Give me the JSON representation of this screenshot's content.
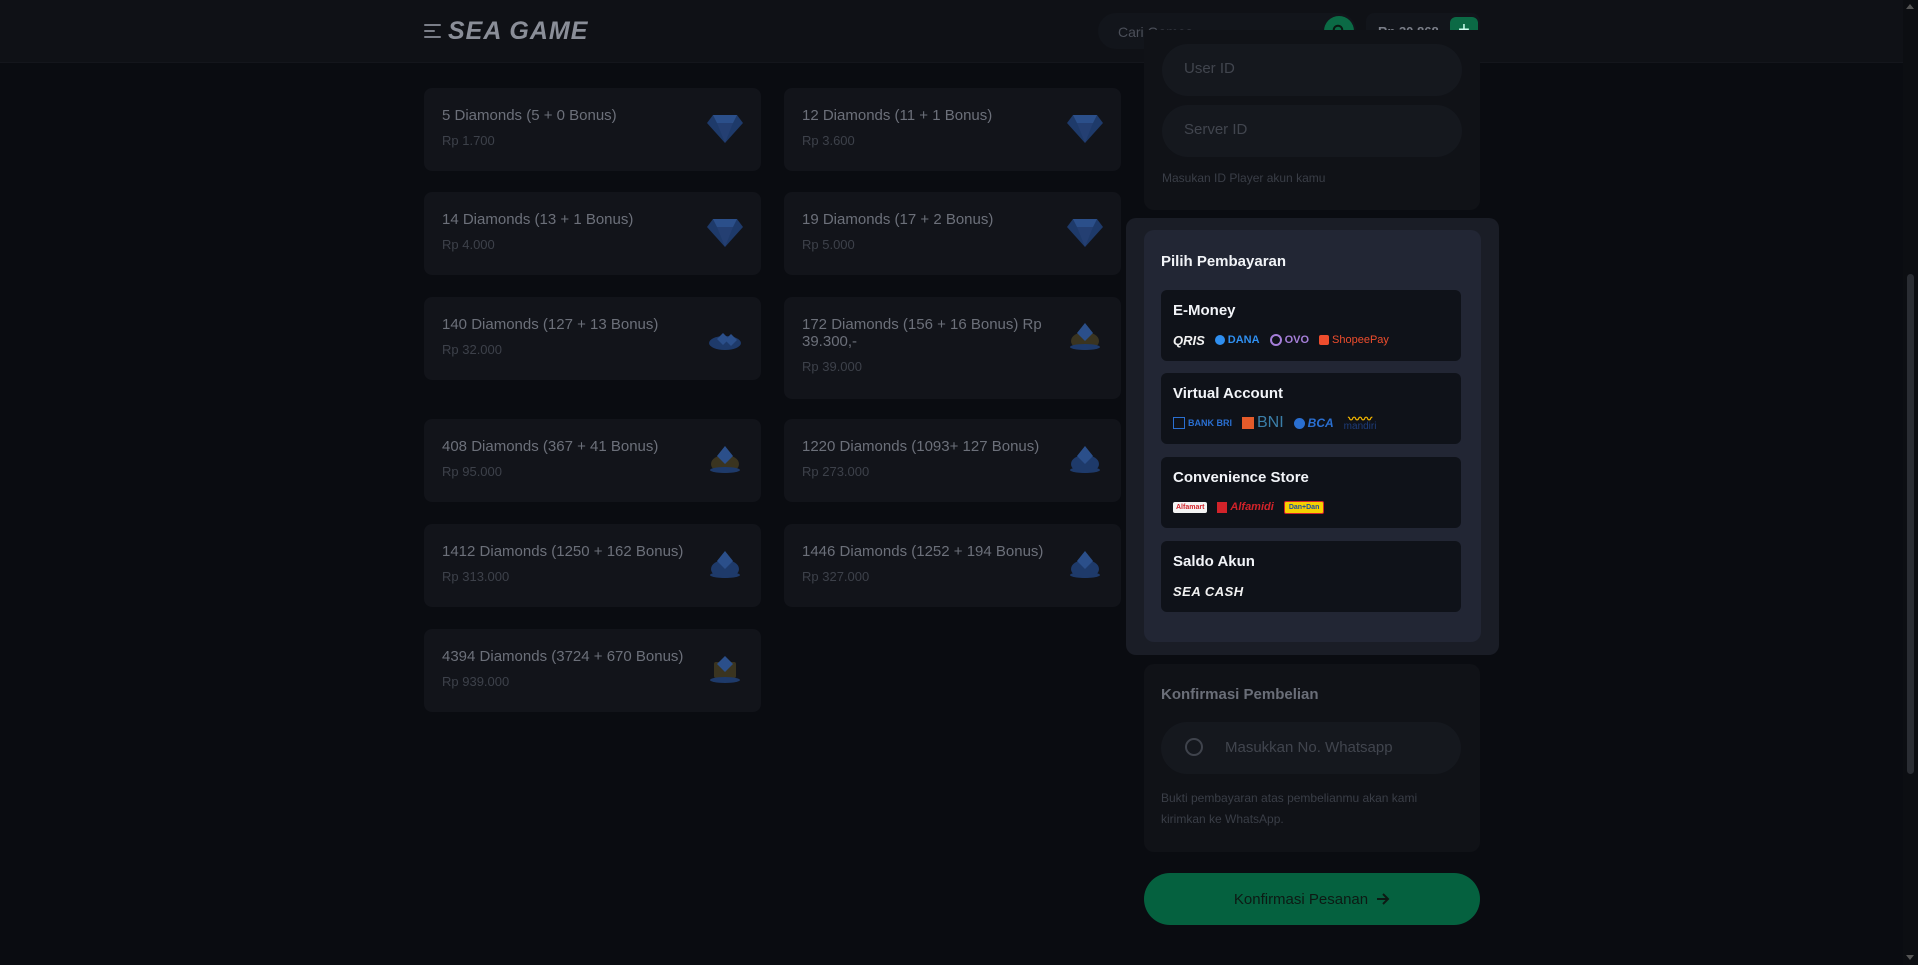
{
  "header": {
    "logo": "SEA GAME",
    "search_placeholder": "Cari Games",
    "balance": "Rp 30.868",
    "topup_label": "+"
  },
  "products": [
    {
      "name": "5 Diamonds (5 + 0 Bonus)",
      "price": "Rp 1.700",
      "icon": "diamond-icon"
    },
    {
      "name": "12 Diamonds (11 + 1 Bonus)",
      "price": "Rp 3.600",
      "icon": "diamond-icon"
    },
    {
      "name": "14 Diamonds (13 + 1 Bonus)",
      "price": "Rp 4.000",
      "icon": "diamond-icon"
    },
    {
      "name": "19 Diamonds (17 + 2 Bonus)",
      "price": "Rp 5.000",
      "icon": "diamond-icon"
    },
    {
      "name": "140 Diamonds (127 + 13 Bonus)",
      "price": "Rp 32.000",
      "icon": "diamond-pile-icon"
    },
    {
      "name": "172 Diamonds (156 + 16 Bonus) Rp 39.300,-",
      "price": "Rp 39.000",
      "icon": "diamond-bag-icon"
    },
    {
      "name": "408 Diamonds (367 + 41 Bonus)",
      "price": "Rp 95.000",
      "icon": "diamond-bag-icon"
    },
    {
      "name": "1220 Diamonds (1093+ 127 Bonus)",
      "price": "Rp 273.000",
      "icon": "diamond-bag-icon"
    },
    {
      "name": "1412 Diamonds (1250 + 162 Bonus)",
      "price": "Rp 313.000",
      "icon": "diamond-bag-icon"
    },
    {
      "name": "1446 Diamonds (1252 + 194 Bonus)",
      "price": "Rp 327.000",
      "icon": "diamond-bag-icon"
    },
    {
      "name": "4394 Diamonds (3724 + 670 Bonus)",
      "price": "Rp 939.000",
      "icon": "diamond-chest-icon"
    }
  ],
  "account": {
    "user_id_placeholder": "User ID",
    "server_id_placeholder": "Server ID",
    "hint": "Masukan ID Player akun kamu"
  },
  "payment": {
    "title": "Pilih Pembayaran",
    "categories": [
      {
        "name": "E-Money",
        "methods": [
          "QRIS",
          "DANA",
          "OVO",
          "ShopeePay"
        ]
      },
      {
        "name": "Virtual Account",
        "methods": [
          "BANK BRI",
          "BNI",
          "BCA",
          "mandiri"
        ]
      },
      {
        "name": "Convenience Store",
        "methods": [
          "Alfamart",
          "Alfamidi",
          "Dan+Dan"
        ]
      },
      {
        "name": "Saldo Akun",
        "methods": [
          "SEA CASH"
        ]
      }
    ]
  },
  "confirm": {
    "title": "Konfirmasi Pembelian",
    "whatsapp_placeholder": "Masukkan No. Whatsapp",
    "hint": "Bukti pembayaran atas pembelianmu akan kami kirimkan ke WhatsApp.",
    "button_label": "Konfirmasi Pesanan"
  },
  "colors": {
    "accent": "#0b6a45",
    "modal_bg": "#222634",
    "category_bg": "#0f1219"
  }
}
